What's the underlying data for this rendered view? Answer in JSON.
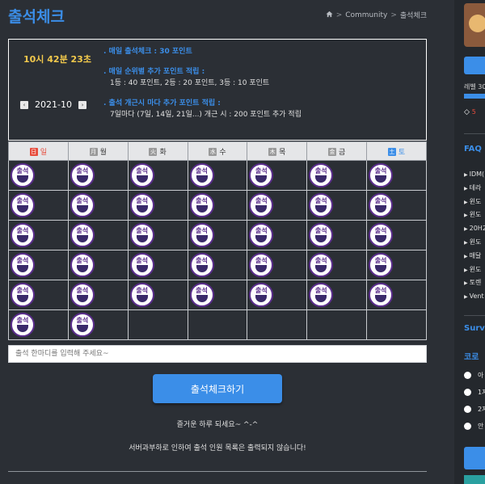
{
  "page": {
    "title": "출석체크"
  },
  "breadcrumb": {
    "home_icon": "home-icon",
    "items": [
      "Community",
      "출석체크"
    ],
    "separator": ">"
  },
  "attendance": {
    "clock": "10시 42분 23초",
    "month": "2021-10",
    "prev_label": "‹",
    "next_label": "›",
    "rules": [
      {
        "title": ". 매일 출석체크 : 30 포인트",
        "lines": []
      },
      {
        "title": ". 매일 순위별 추가 포인트 적립 :",
        "lines": [
          "1등 : 40 포인트,  2등 : 20 포인트,  3등 : 10 포인트"
        ]
      },
      {
        "title": ". 출석 개근시 마다 추가 포인트 적립 :",
        "lines": [
          "7일마다 (7일, 14일, 21일...) 개근 시 : 200 포인트 추가 적립"
        ]
      }
    ]
  },
  "calendar": {
    "weekdays": [
      {
        "char": "日",
        "label": "일",
        "type": "sun"
      },
      {
        "char": "月",
        "label": "월",
        "type": "wk"
      },
      {
        "char": "火",
        "label": "화",
        "type": "wk"
      },
      {
        "char": "水",
        "label": "수",
        "type": "wk"
      },
      {
        "char": "木",
        "label": "목",
        "type": "wk"
      },
      {
        "char": "金",
        "label": "금",
        "type": "wk"
      },
      {
        "char": "土",
        "label": "토",
        "type": "sat"
      }
    ],
    "stamp_top": "출석",
    "stamp_bottom": "体",
    "rows": [
      [
        true,
        true,
        true,
        true,
        true,
        true,
        true
      ],
      [
        true,
        true,
        true,
        true,
        true,
        true,
        true
      ],
      [
        true,
        true,
        true,
        true,
        true,
        true,
        true
      ],
      [
        true,
        true,
        true,
        true,
        true,
        true,
        true
      ],
      [
        true,
        true,
        true,
        true,
        true,
        true,
        true
      ],
      [
        true,
        true,
        false,
        false,
        false,
        false,
        false
      ]
    ]
  },
  "form": {
    "input_placeholder": "출석 한마디를 입력해 주세요~",
    "submit_label": "출석체크하기",
    "note1": "즐거운 하루 되세요~ ^-^",
    "note2": "서버과부하로 인하여 출석 인원 목록은 출력되지 않습니다!"
  },
  "sidebar": {
    "level_label": "레벨 30",
    "gem_value": "5",
    "faq_title": "FAQ",
    "faq_items": [
      "IDM(",
      "테라",
      "윈도",
      "윈도",
      "20H2",
      "윈도",
      "매달",
      "윈도",
      "토렌",
      "Vent"
    ],
    "survey_title": "Surv",
    "survey_question": "코로",
    "survey_options": [
      "아",
      "1지",
      "2지",
      "안"
    ]
  },
  "colors": {
    "accent": "#3b8ee8",
    "background": "#2b2f35",
    "clock": "#f2c94c",
    "sunday": "#e74c3c"
  }
}
